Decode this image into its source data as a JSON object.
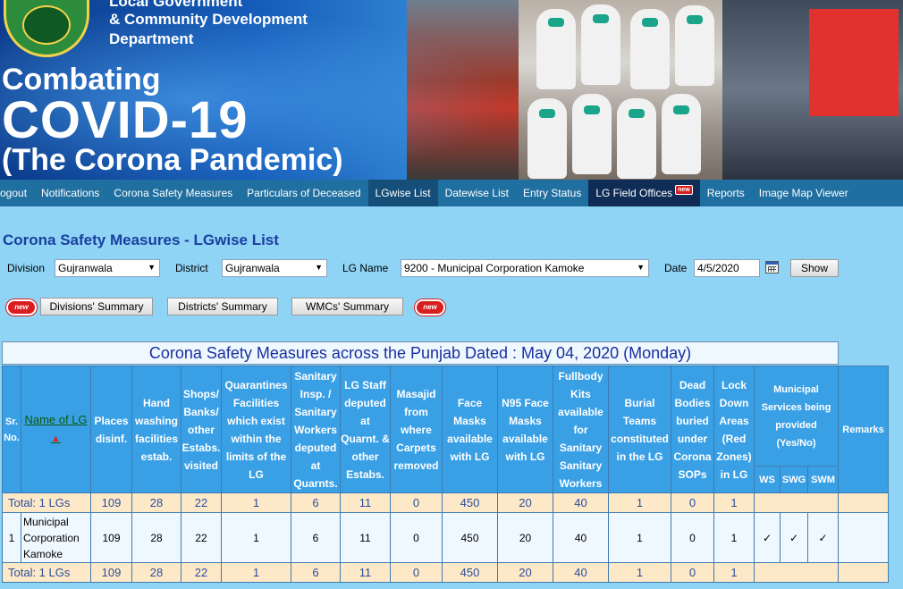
{
  "banner": {
    "dept_line1": "Local Government",
    "dept_line2": "& Community Development",
    "dept_line3": "Department",
    "title_line1": "Combating",
    "title_line2": "COVID-19",
    "title_line3": "(The Corona Pandemic)"
  },
  "nav": {
    "items": [
      {
        "label": "ogout"
      },
      {
        "label": "Notifications"
      },
      {
        "label": "Corona Safety Measures"
      },
      {
        "label": "Particulars of Deceased"
      },
      {
        "label": "LGwise List"
      },
      {
        "label": "Datewise List"
      },
      {
        "label": "Entry Status"
      },
      {
        "label": "LG Field Offices"
      },
      {
        "label": "Reports"
      },
      {
        "label": "Image Map Viewer"
      }
    ],
    "new_badge": "new"
  },
  "page": {
    "title": "Corona Safety Measures - LGwise List"
  },
  "filter": {
    "division_label": "Division",
    "division_value": "Gujranwala",
    "district_label": "District",
    "district_value": "Gujranwala",
    "lg_label": "LG Name",
    "lg_value": "9200 - Municipal Corporation Kamoke",
    "date_label": "Date",
    "date_value": "4/5/2020",
    "show_button": "Show"
  },
  "summary_buttons": {
    "divisions": "Divisions' Summary",
    "districts": "Districts' Summary",
    "wmcs": "WMCs' Summary",
    "new_badge": "new"
  },
  "table": {
    "caption": "Corona Safety Measures across the Punjab Dated : May 04, 2020 (Monday)",
    "headers": {
      "sr": "Sr. No.",
      "name": "Name of LG",
      "places": "Places disinf.",
      "hand": "Hand washing facilities estab.",
      "shops": "Shops/ Banks/ other Estabs. visited",
      "quarantine": "Quarantines Facilities which exist within the limits of the LG",
      "sanitary": "Sanitary Insp. / Sanitary Workers deputed at Quarnts.",
      "staff": "LG Staff deputed at Quarnt. & other Estabs.",
      "masajid": "Masajid from where Carpets removed",
      "face": "Face Masks available with LG",
      "n95": "N95 Face Masks available with LG",
      "fullbody": "Fullbody Kits available for Sanitary Sanitary Workers",
      "burial": "Burial Teams constituted in the LG",
      "dead": "Dead Bodies buried under Corona SOPs",
      "lockdown": "Lock Down Areas (Red Zones) in LG",
      "municipal": "Municipal Services being provided (Yes/No)",
      "ws": "WS",
      "swg": "SWG",
      "swm": "SWM",
      "remarks": "Remarks"
    },
    "total_label": "Total: 1 LGs",
    "totals": [
      "109",
      "28",
      "22",
      "1",
      "6",
      "11",
      "0",
      "450",
      "20",
      "40",
      "1",
      "0",
      "1"
    ],
    "row": {
      "sr": "1",
      "name": "Municipal Corporation Kamoke",
      "values": [
        "109",
        "28",
        "22",
        "1",
        "6",
        "11",
        "0",
        "450",
        "20",
        "40",
        "1",
        "0",
        "1"
      ],
      "ws": "✓",
      "swg": "✓",
      "swm": "✓"
    }
  }
}
